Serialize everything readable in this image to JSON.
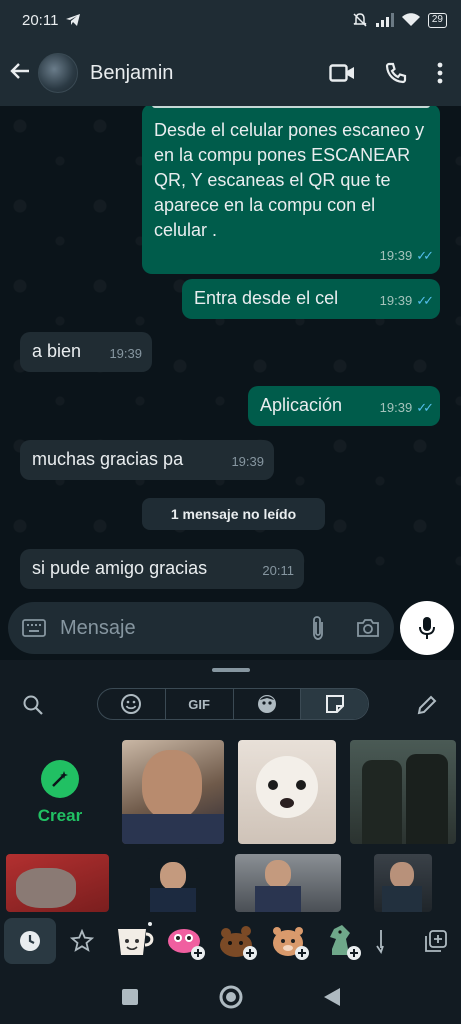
{
  "status": {
    "time": "20:11",
    "battery": "29"
  },
  "header": {
    "contact_name": "Benjamin"
  },
  "messages": {
    "m1": {
      "text": "Desde el celular pones escaneo y en la compu pones ESCANEAR QR, Y escaneas el QR que te aparece en la compu con el celular .",
      "time": "19:39"
    },
    "m2": {
      "text": "Entra desde el cel",
      "time": "19:39"
    },
    "m3": {
      "text": "a bien",
      "time": "19:39"
    },
    "m4": {
      "text": "Aplicación",
      "time": "19:39"
    },
    "m5": {
      "text": "muchas gracias pa",
      "time": "19:39"
    },
    "m6": {
      "text": "si pude amigo gracias",
      "time": "20:11"
    }
  },
  "unread_divider": "1 mensaje no leído",
  "composer": {
    "placeholder": "Mensaje"
  },
  "panel": {
    "tabs": [
      "emoji-icon",
      "GIF",
      "avatar-icon",
      "sticker-icon"
    ],
    "gif_label": "GIF",
    "crear_label": "Crear"
  },
  "colors": {
    "accent": "#21c063",
    "outgoing": "#005c4b",
    "incoming": "#202c33",
    "background": "#0b141a"
  }
}
